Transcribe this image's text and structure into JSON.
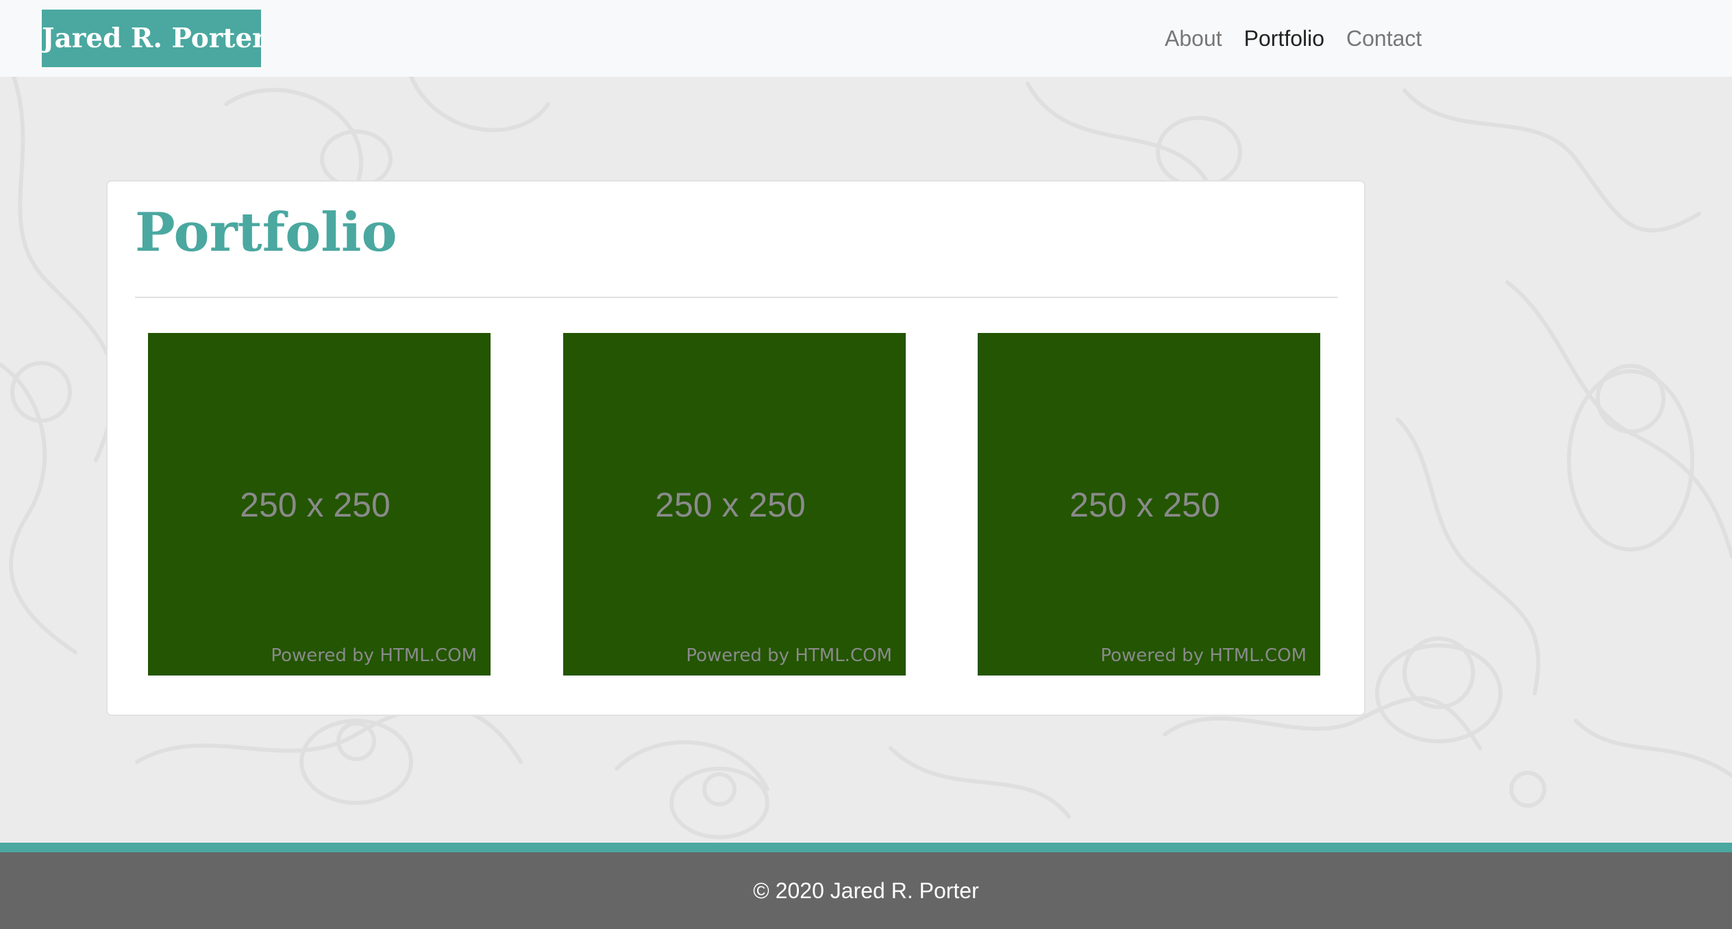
{
  "navbar": {
    "brand": "Jared R. Porter",
    "links": [
      {
        "label": "About",
        "active": false
      },
      {
        "label": "Portfolio",
        "active": true
      },
      {
        "label": "Contact",
        "active": false
      }
    ]
  },
  "main": {
    "title": "Portfolio",
    "thumbnails": [
      {
        "size_text": "250 x 250",
        "powered": "Powered by HTML.COM"
      },
      {
        "size_text": "250 x 250",
        "powered": "Powered by HTML.COM"
      },
      {
        "size_text": "250 x 250",
        "powered": "Powered by HTML.COM"
      }
    ]
  },
  "footer": {
    "text": "© 2020 Jared R. Porter"
  },
  "colors": {
    "accent": "#4aa8a0",
    "nav_bg": "#f8f9fa",
    "page_bg": "#ebebeb",
    "thumbnail_bg": "#235502",
    "footer_bg": "#666666"
  }
}
